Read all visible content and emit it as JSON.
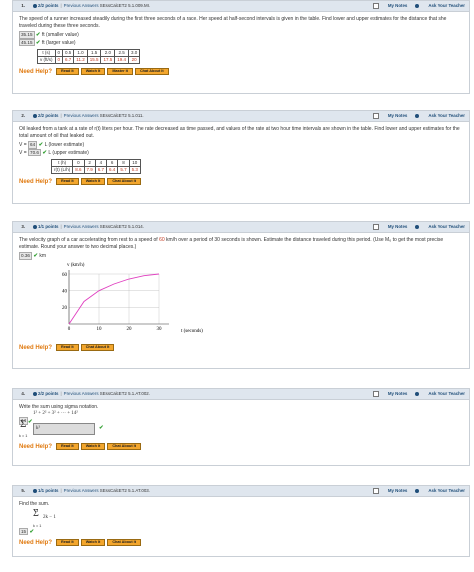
{
  "common": {
    "my_notes": "My Notes",
    "ask": "Ask Your Teacher",
    "previous": "Previous Answers",
    "need_help": "Need Help?",
    "read_it": "Read It",
    "watch_it": "Watch It",
    "master_it": "Master It",
    "chat": "Chat About It",
    "sep": "|"
  },
  "q1": {
    "num": "1.",
    "points": "2/2 points",
    "code": "SEssCalcET2 5.1.009.MI.",
    "text": "The speed of a runner increased steadily during the first three seconds of a race. Her speed at half-second intervals is given in the table. Find lower and upper estimates for the distance that she traveled during these three seconds.",
    "a1": "35.15",
    "u1": "ft (smaller value)",
    "a2": "45.15",
    "u2": "ft (larger value)",
    "row1": [
      "t (s)",
      "0",
      "0.5",
      "1.0",
      "1.5",
      "2.0",
      "2.5",
      "3.0"
    ],
    "row2": [
      "v (ft/s)",
      "0",
      "6.7",
      "11.2",
      "15.5",
      "17.5",
      "19.4",
      "20"
    ]
  },
  "q2": {
    "num": "2.",
    "points": "2/2 points",
    "code": "SEssCalcET2 5.1.011.",
    "text": "Oil leaked from a tank at a rate of r(t) liters per hour. The rate decreased as time passed, and values of the rate at two hour time intervals are shown in the table. Find lower and upper estimates for the total amount of oil that leaked out.",
    "v1": "V =",
    "a1": "64",
    "u1": "L (lower estimate)",
    "v2": "V =",
    "a2": "70.6",
    "u2": "L (upper estimate)",
    "row1": [
      "t (h)",
      "0",
      "2",
      "4",
      "6",
      "8",
      "10"
    ],
    "row2": [
      "r(t) (L/h)",
      "8.6",
      "7.9",
      "6.7",
      "6.4",
      "5.7",
      "5.3"
    ]
  },
  "q3": {
    "num": "3.",
    "points": "1/1 points",
    "code": "SEssCalcET2 5.1.014.",
    "text_a": "The velocity graph of a car accelerating from rest to a speed of ",
    "text_red": "60",
    "text_b": " km/h over a period of 30 seconds is shown. Estimate the distance traveled during this period. (Use M₆ to get the most precise estimate. Round your answer to two decimal places.)",
    "ans": "0.36",
    "unit": "km",
    "ylabel": "v (km/h)",
    "xlabel": "t (seconds)",
    "yticks": [
      "60",
      "40",
      "20"
    ],
    "xticks": [
      "0",
      "10",
      "20",
      "30"
    ]
  },
  "q4": {
    "num": "4.",
    "points": "2/2 points",
    "code": "SEssCalcET2 5.1.AT.002.",
    "text": "Write the sum using sigma notation.",
    "series": "1² + 2² + 3² + ··· + 14²",
    "upper": "14",
    "expr": "k²",
    "lower": "k = 1"
  },
  "q5": {
    "num": "5.",
    "points": "1/1 points",
    "code": "SEssCalcET2 5.1.AT.003.",
    "text": "Find the sum.",
    "upper": "3",
    "expr": "2k − 1",
    "lower": "k = 1",
    "ans": "15"
  },
  "chart_data": {
    "type": "line",
    "xlabel": "t (seconds)",
    "ylabel": "v (km/h)",
    "xlim": [
      0,
      30
    ],
    "ylim": [
      0,
      60
    ],
    "x": [
      0,
      5,
      10,
      15,
      20,
      25,
      30
    ],
    "y": [
      0,
      27,
      40,
      48,
      54,
      58,
      60
    ]
  }
}
